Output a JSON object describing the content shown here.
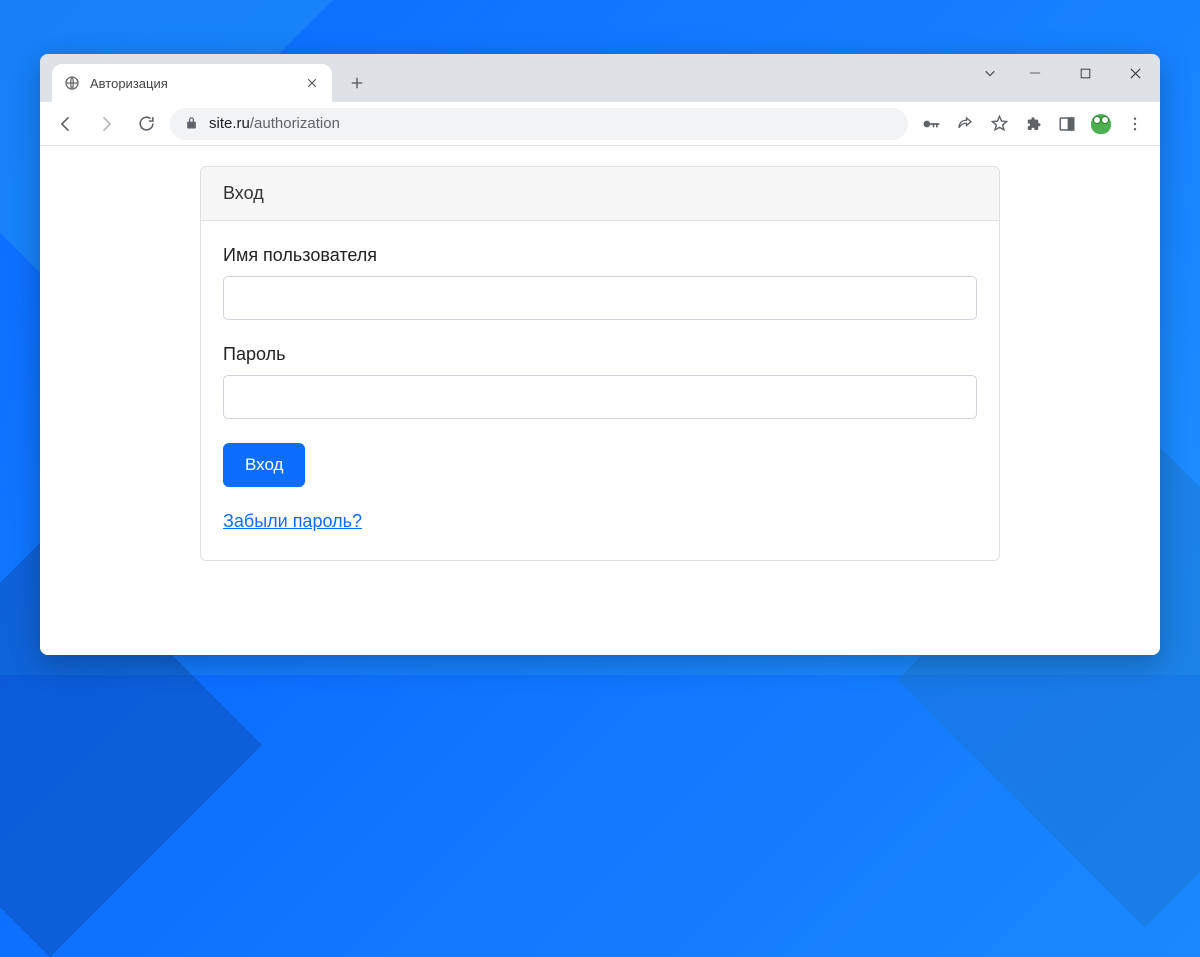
{
  "browser": {
    "tab_title": "Авторизация",
    "url_domain": "site.ru",
    "url_path": "/authorization"
  },
  "form": {
    "card_title": "Вход",
    "username_label": "Имя пользователя",
    "password_label": "Пароль",
    "submit_label": "Вход",
    "forgot_label": "Забыли пароль?"
  }
}
